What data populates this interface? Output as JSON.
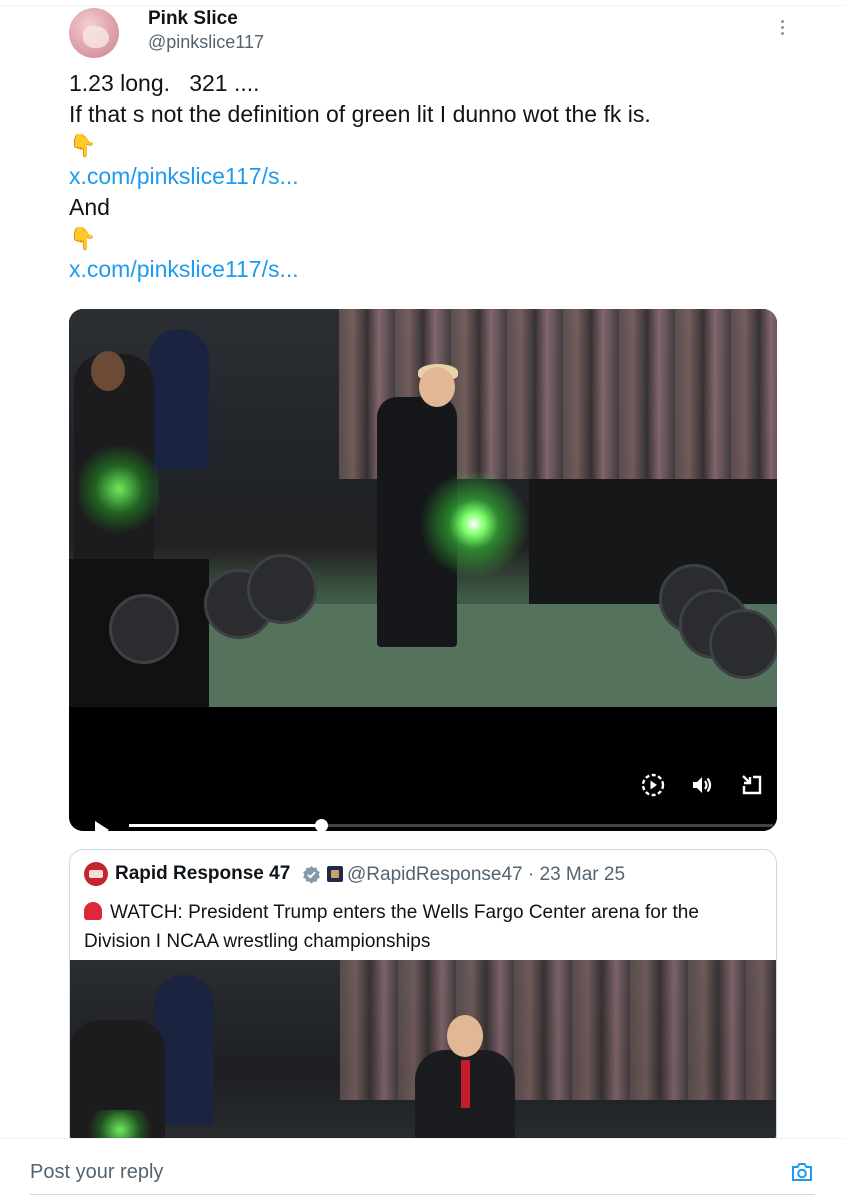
{
  "post": {
    "display_name": "Pink Slice",
    "handle": "@pinkslice117",
    "text_line1": "1.23 long.   321 ....",
    "text_line2": "If that s not the definition of green lit I dunno wot the fk is.",
    "emoji1": "👇",
    "link1": "x.com/pinkslice117/s...",
    "text_and": "And",
    "emoji2": "👇",
    "link2": "x.com/pinkslice117/s..."
  },
  "video": {
    "progress_fraction": 0.3
  },
  "quote": {
    "name": "Rapid Response 47",
    "handle_date": "@RapidResponse47 · 23 Mar 25",
    "text_line1": "WATCH: President Trump enters the Wells Fargo Center arena for the",
    "text_line2": "Division I NCAA wrestling championships"
  },
  "reply": {
    "placeholder": "Post your reply"
  },
  "colors": {
    "link": "#1d9bf0",
    "verified": "#829aab",
    "siren": "#e0263b"
  }
}
